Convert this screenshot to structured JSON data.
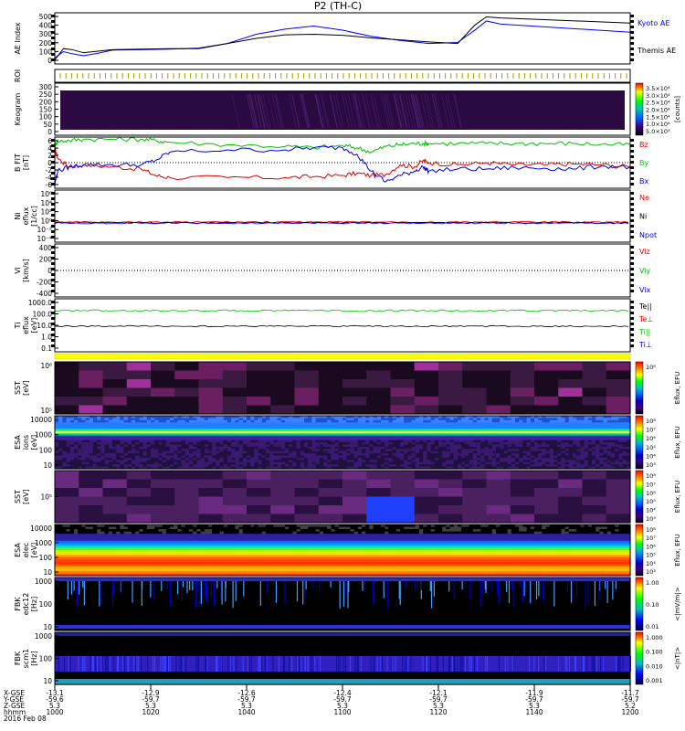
{
  "title": "P2 (TH-C)",
  "chart_data": [
    {
      "type": "line",
      "panel": "ae",
      "ylabel": "AE Index",
      "yticks": [
        "500",
        "400",
        "300",
        "200",
        "100",
        "0"
      ],
      "ylim": [
        0,
        500
      ],
      "x": [
        1000,
        1003,
        1006,
        1010,
        1015,
        1020,
        1030,
        1040,
        1050,
        1060,
        1070,
        1080,
        1090,
        1100,
        1110,
        1120,
        1130,
        1140,
        1143,
        1146,
        1150,
        1155,
        1200
      ],
      "series": [
        {
          "name": "Kyoto AE",
          "color": "#0000ff",
          "values": [
            60,
            120,
            100,
            80,
            105,
            135,
            140,
            145,
            155,
            200,
            290,
            340,
            370,
            330,
            270,
            230,
            200,
            210,
            270,
            330,
            420,
            390,
            310
          ]
        },
        {
          "name": "Themis AE",
          "color": "#000000",
          "values": [
            40,
            150,
            140,
            110,
            125,
            140,
            145,
            150,
            150,
            200,
            250,
            285,
            290,
            280,
            255,
            235,
            215,
            200,
            290,
            380,
            460,
            450,
            400
          ]
        }
      ]
    },
    {
      "type": "line",
      "panel": "b",
      "ylabel": [
        "B FIT",
        "[nT]"
      ],
      "yticks": [
        "6",
        "4",
        "2",
        "0",
        "-2",
        "-4",
        "-6"
      ],
      "ylim": [
        -6,
        6
      ],
      "x": [
        1000,
        1001,
        1005,
        1010,
        1020,
        1030,
        1035,
        1040,
        1060,
        1080,
        1090,
        1100,
        1105,
        1110,
        1115,
        1120,
        1125,
        1128,
        1130,
        1140,
        1150,
        1160,
        1170,
        1180,
        1190,
        1200
      ],
      "series": [
        {
          "name": "Bz",
          "color": "#e00000",
          "values": [
            3.5,
            1,
            -1,
            -0.5,
            -1,
            -1.5,
            -3,
            -3.5,
            -3.5,
            -3.5,
            -3.3,
            -3,
            -2.5,
            -3,
            -2.8,
            -0.5,
            -1,
            0.5,
            0,
            -0.5,
            0,
            -0.5,
            -0.5,
            -0.3,
            -0.5,
            -1
          ]
        },
        {
          "name": "By",
          "color": "#00c000",
          "values": [
            4,
            5,
            5.2,
            5.5,
            5.5,
            5.5,
            5.2,
            4.8,
            4.2,
            3.8,
            3.5,
            4,
            3.5,
            2.5,
            3.8,
            4.2,
            4.5,
            4.5,
            4.5,
            4.5,
            4.5,
            4.5,
            4.5,
            4.5,
            4.3,
            4.2
          ]
        },
        {
          "name": "Bx",
          "color": "#0000e0",
          "values": [
            -5,
            -2,
            -1,
            -0.5,
            -0.5,
            -0.5,
            0.5,
            2.5,
            3,
            3,
            3.5,
            3.5,
            2,
            -2,
            -4.5,
            -3,
            -2,
            -1,
            -2,
            -1.5,
            -1.5,
            -1.2,
            -1.3,
            -1.5,
            -0.8,
            -1
          ]
        }
      ]
    },
    {
      "type": "line",
      "panel": "ni",
      "ylabel": [
        "Ni",
        "eflux",
        "[1/cc]"
      ],
      "yticks": [
        "10⁶",
        "10⁴",
        "10²",
        "10⁰",
        "10⁻²",
        "10⁻⁴"
      ],
      "series": [
        {
          "name": "Ne",
          "color": "#e00000"
        },
        {
          "name": "Ni",
          "color": "#000000"
        },
        {
          "name": "Npot",
          "color": "#0000e0"
        }
      ]
    },
    {
      "type": "line",
      "panel": "vi",
      "ylabel": [
        "Vi",
        "[km/s]"
      ],
      "yticks": [
        "400",
        "200",
        "0",
        "-200",
        "-400"
      ],
      "series": [
        {
          "name": "Viz",
          "color": "#e00000"
        },
        {
          "name": "Viy",
          "color": "#00c000"
        },
        {
          "name": "Vix",
          "color": "#0000e0"
        }
      ]
    },
    {
      "type": "line",
      "panel": "ti",
      "ylabel": [
        "Ti",
        "eflux",
        "[eV]"
      ],
      "yticks": [
        "1000.0",
        "100.0",
        "10.0",
        "1.0",
        "0.1"
      ],
      "series": [
        {
          "name": "Te||",
          "color": "#000000"
        },
        {
          "name": "Te⊥",
          "color": "#e00000"
        },
        {
          "name": "Ti||",
          "color": "#00c000"
        },
        {
          "name": "Ti⊥",
          "color": "#0000e0"
        }
      ]
    }
  ],
  "labels": {
    "roi": "ROI",
    "keo_ylabel": "Keogram",
    "keo_yticks": [
      "300",
      "250",
      "200",
      "150",
      "100",
      "50",
      "0"
    ],
    "keo_colorbar": [
      "3.5×10⁴",
      "3.0×10⁴",
      "2.5×10⁴",
      "2.0×10⁴",
      "1.5×10⁴",
      "1.0×10⁴",
      "5.0×10³"
    ],
    "keo_colorbar_unit": "[counts]",
    "sst_i_ylabel": [
      "SST",
      "[eV]"
    ],
    "sst_i_yticks": [
      "10⁶",
      "10⁵"
    ],
    "esa_i_ylabel": [
      "ESA",
      "ions",
      "[eV]"
    ],
    "esa_i_yticks": [
      "10000",
      "1000",
      "100",
      "10"
    ],
    "sst_e_ylabel": [
      "SST",
      "[eV]"
    ],
    "sst_e_yticks": [
      "10⁵"
    ],
    "esa_e_ylabel": [
      "ESA",
      "elec",
      "[eV]"
    ],
    "esa_e_yticks": [
      "10000",
      "1000",
      "100",
      "10"
    ],
    "fbk1_ylabel": [
      "FBK",
      "edc12",
      "[Hz]"
    ],
    "fbk1_yticks": [
      "1000",
      "100",
      "10"
    ],
    "fbk2_ylabel": [
      "FBK",
      "scm1",
      "[Hz]"
    ],
    "fbk2_yticks": [
      "1000",
      "100",
      "10"
    ],
    "eflux_cb_ticks": [
      "10⁸",
      "10⁷",
      "10⁶",
      "10⁵",
      "10⁴",
      "10³"
    ],
    "eflux_unit": "Eflux, EFU",
    "fbk1_cb_ticks": [
      "1.00",
      "0.10",
      "0.01"
    ],
    "fbk1_cb_unit": "<|mV/m|>",
    "fbk2_cb_ticks": [
      "1.000",
      "0.100",
      "0.010",
      "0.001"
    ],
    "fbk2_cb_unit": "<|nT|>"
  },
  "ephemeris": {
    "row_labels": [
      "X-GSE",
      "Y-GSE",
      "Z-GSE",
      "hhmm",
      "2016 Feb 08"
    ],
    "columns": [
      [
        "-13.1",
        "-59.6",
        "5.3",
        "1000"
      ],
      [
        "-12.9",
        "-59.7",
        "5.3",
        "1020"
      ],
      [
        "-12.6",
        "-59.7",
        "5.3",
        "1040"
      ],
      [
        "-12.4",
        "-59.7",
        "5.3",
        "1100"
      ],
      [
        "-12.1",
        "-59.7",
        "5.3",
        "1120"
      ],
      [
        "-11.9",
        "-59.7",
        "5.3",
        "1140"
      ],
      [
        "-11.7",
        "-59.7",
        "5.2",
        "1200"
      ]
    ]
  }
}
